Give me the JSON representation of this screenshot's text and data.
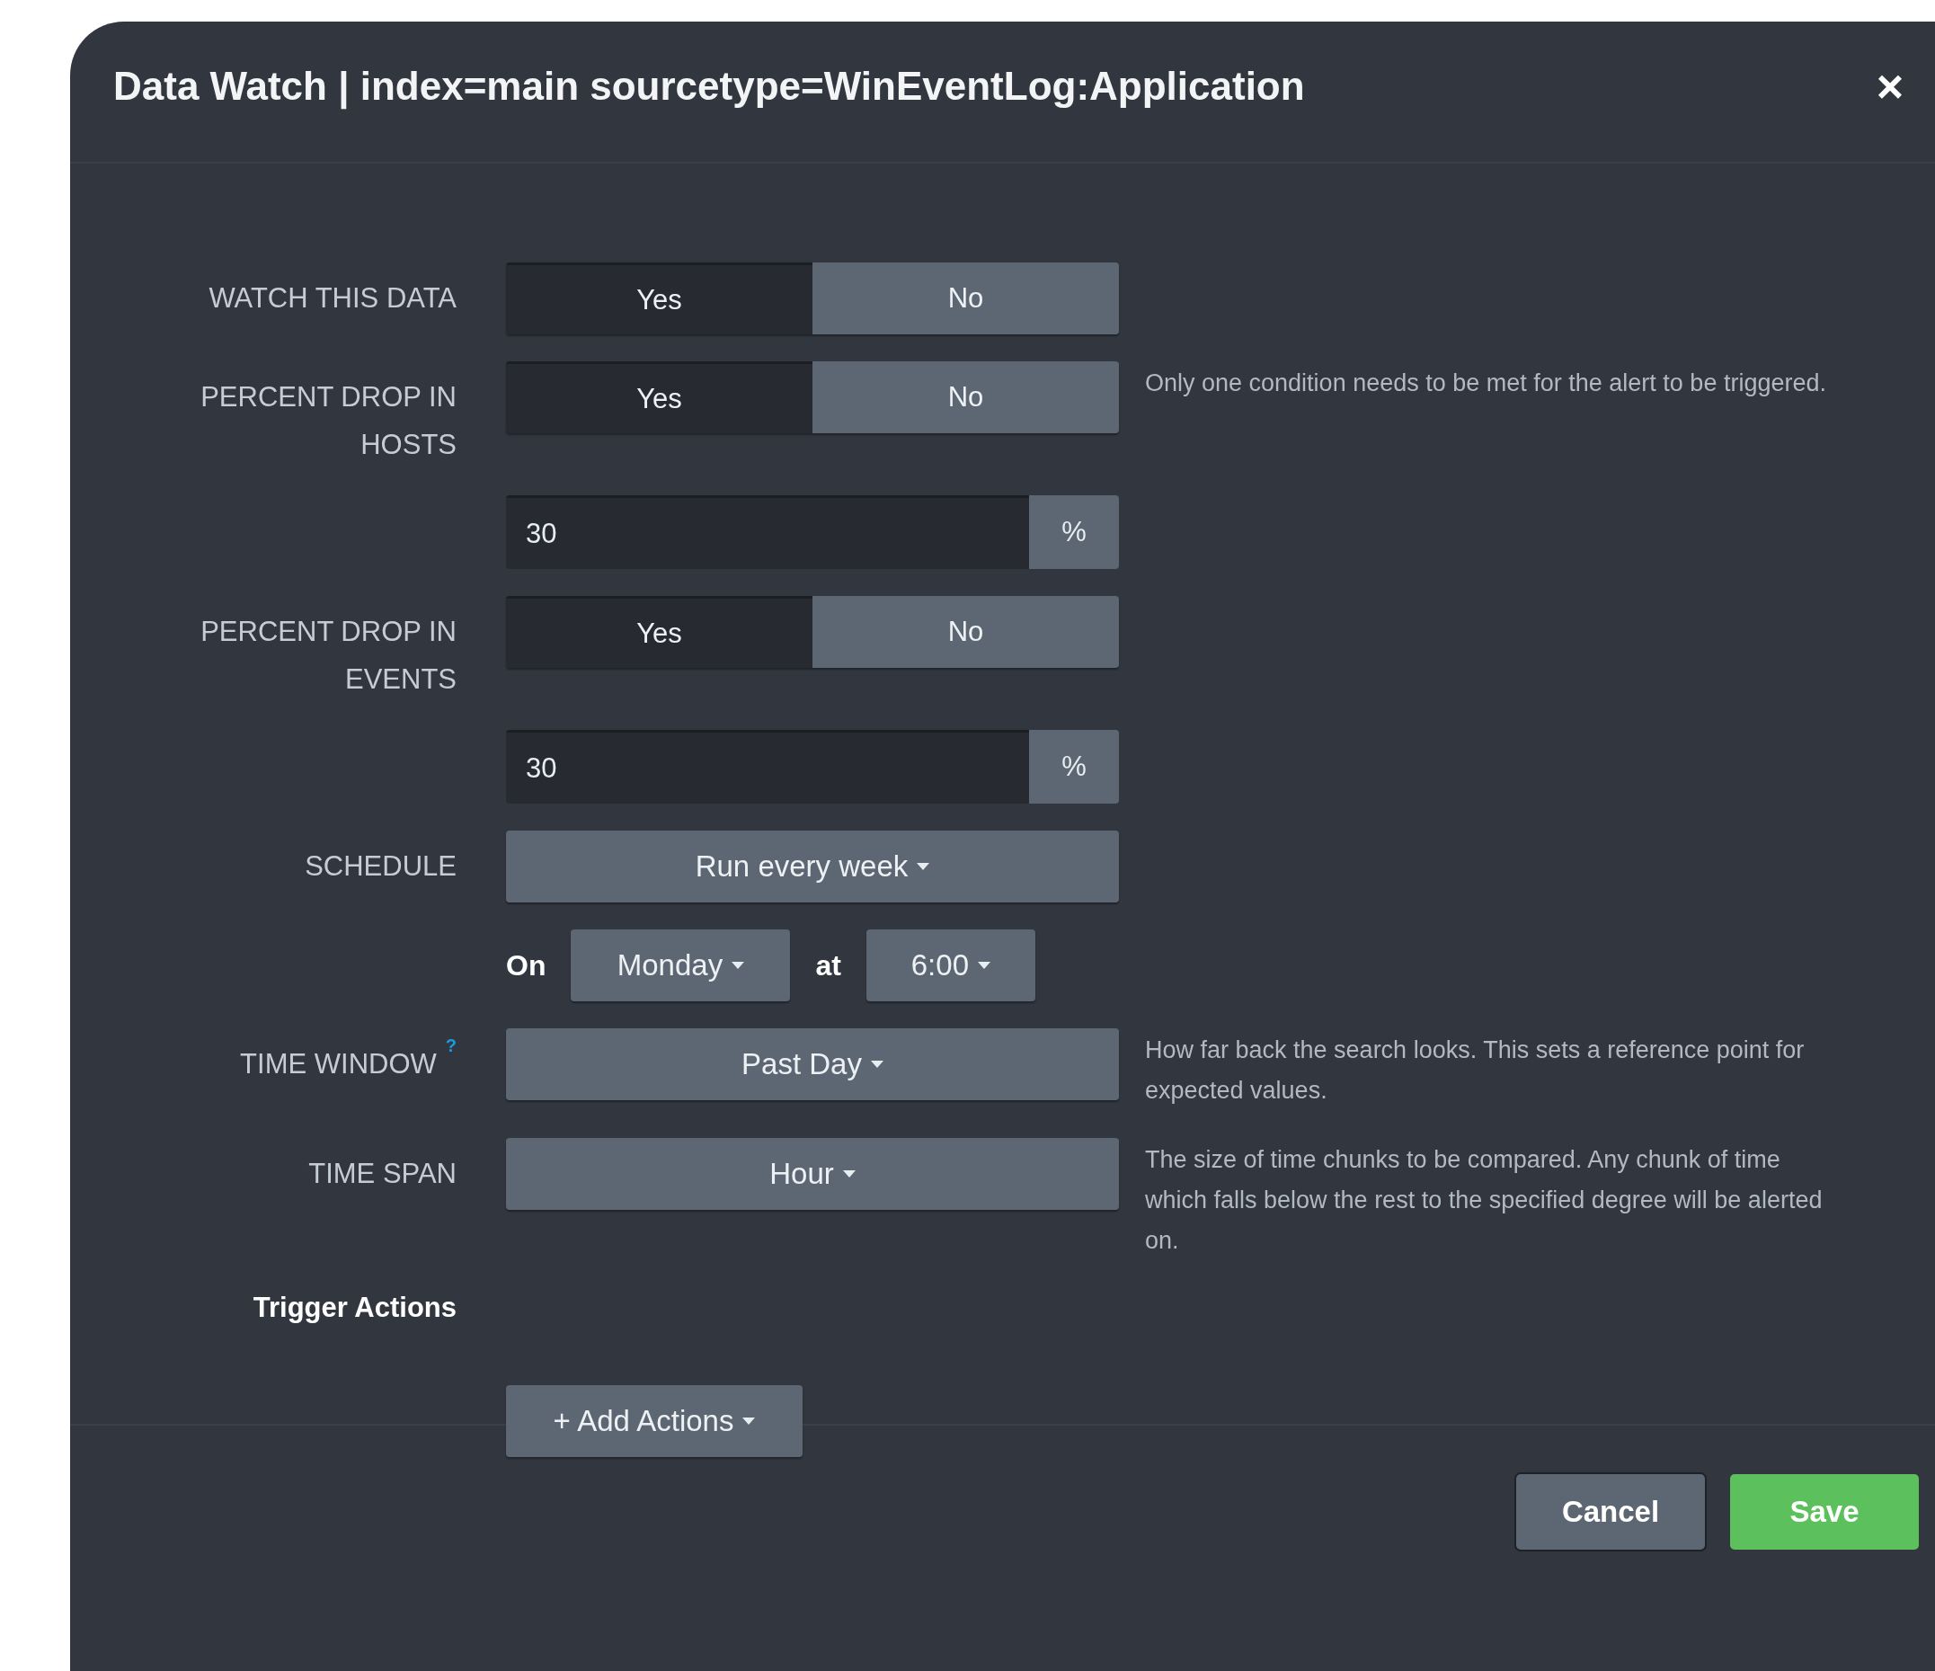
{
  "dialog": {
    "title": "Data Watch | index=main sourcetype=WinEventLog:Application",
    "close_label": "×"
  },
  "fields": [
    {
      "kind": "toggle",
      "label": "WATCH THIS DATA",
      "options": [
        {
          "label": "Yes",
          "selected": true
        },
        {
          "label": "No",
          "selected": false
        }
      ]
    },
    {
      "kind": "toggle",
      "label": "PERCENT DROP IN HOSTS",
      "options": [
        {
          "label": "Yes",
          "selected": true
        },
        {
          "label": "No",
          "selected": false
        }
      ],
      "help": "Only one condition needs to be met for the alert to be triggered."
    },
    {
      "kind": "number",
      "value": "30",
      "unit": "%"
    },
    {
      "kind": "toggle",
      "label": "PERCENT DROP IN EVENTS",
      "options": [
        {
          "label": "Yes",
          "selected": true
        },
        {
          "label": "No",
          "selected": false
        }
      ]
    },
    {
      "kind": "number",
      "value": "30",
      "unit": "%"
    },
    {
      "kind": "dropdown",
      "label": "SCHEDULE",
      "value": "Run every week"
    },
    {
      "kind": "day_time",
      "on_label": "On",
      "day": "Monday",
      "at_label": "at",
      "time": "6:00"
    },
    {
      "kind": "dropdown",
      "label": "TIME WINDOW",
      "help_marker": "?",
      "value": "Past Day",
      "help": "How far back the search looks. This sets a reference point for expected values."
    },
    {
      "kind": "dropdown",
      "label": "TIME SPAN",
      "value": "Hour",
      "help": "The size of time chunks to be compared. Any chunk of time which falls below the rest to the specified degree will be alerted on."
    },
    {
      "kind": "heading",
      "label": "Trigger Actions"
    },
    {
      "kind": "add_button",
      "value": "+ Add Actions"
    }
  ],
  "footer": {
    "buttons": [
      {
        "label": "Cancel",
        "kind": "secondary"
      },
      {
        "label": "Save",
        "kind": "primary"
      }
    ]
  }
}
